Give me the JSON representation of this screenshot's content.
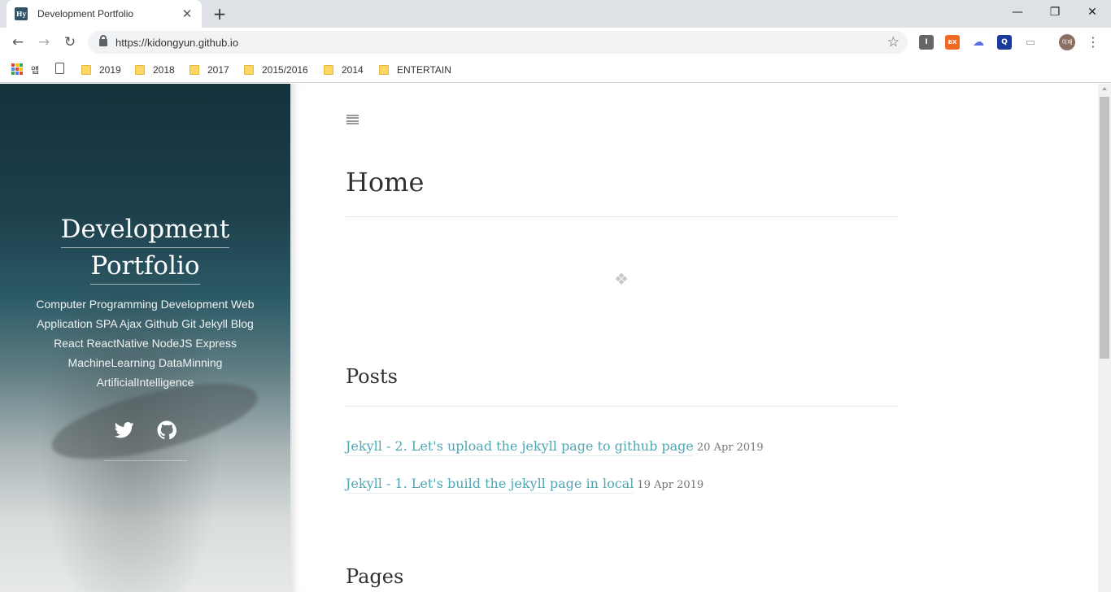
{
  "browser": {
    "tab": {
      "favicon_text": "Hy",
      "title": "Development Portfolio",
      "close": "✕"
    },
    "new_tab": "+",
    "window_controls": {
      "minimize": "—",
      "restore": "❐",
      "close": "✕"
    },
    "nav": {
      "back": "←",
      "forward": "→",
      "reload": "↻"
    },
    "url": "https://kidongyun.github.io",
    "bookmark_star": "☆",
    "extensions": [
      {
        "label": "I",
        "color": "#666666"
      },
      {
        "label": "BX",
        "color": "#f26a21"
      },
      {
        "label": "☁",
        "color": "#ffffff"
      },
      {
        "label": "Q",
        "color": "#1a3b9c"
      },
      {
        "label": "▭",
        "color": "#ffffff"
      }
    ],
    "avatar_text": "이재",
    "menu": "⋮",
    "bookmarks_bar": {
      "apps_label": "앱",
      "folders": [
        "2019",
        "2018",
        "2017",
        "2015/2016",
        "2014",
        "ENTERTAIN"
      ]
    }
  },
  "sidebar": {
    "title_line1": "Development",
    "title_line2": "Portfolio",
    "description_lines": [
      "Computer Programming Development Web",
      "Application SPA Ajax Github Git Jekyll Blog",
      "React ReactNative NodeJS Express",
      "MachineLearning DataMinning",
      "ArtificialIntelligence"
    ],
    "social_icons": [
      "twitter-icon",
      "github-icon"
    ]
  },
  "main": {
    "page_title": "Home",
    "ornament": "❖",
    "posts_heading": "Posts",
    "posts": [
      {
        "title": "Jekyll - 2. Let's upload the jekyll page to github page",
        "date": "20 Apr 2019"
      },
      {
        "title": "Jekyll - 1. Let's build the jekyll page in local",
        "date": "19 Apr 2019"
      }
    ],
    "pages_heading": "Pages"
  },
  "colors": {
    "link": "#4fa7b4",
    "sidebar_top": "#15313c",
    "text": "#313131"
  }
}
